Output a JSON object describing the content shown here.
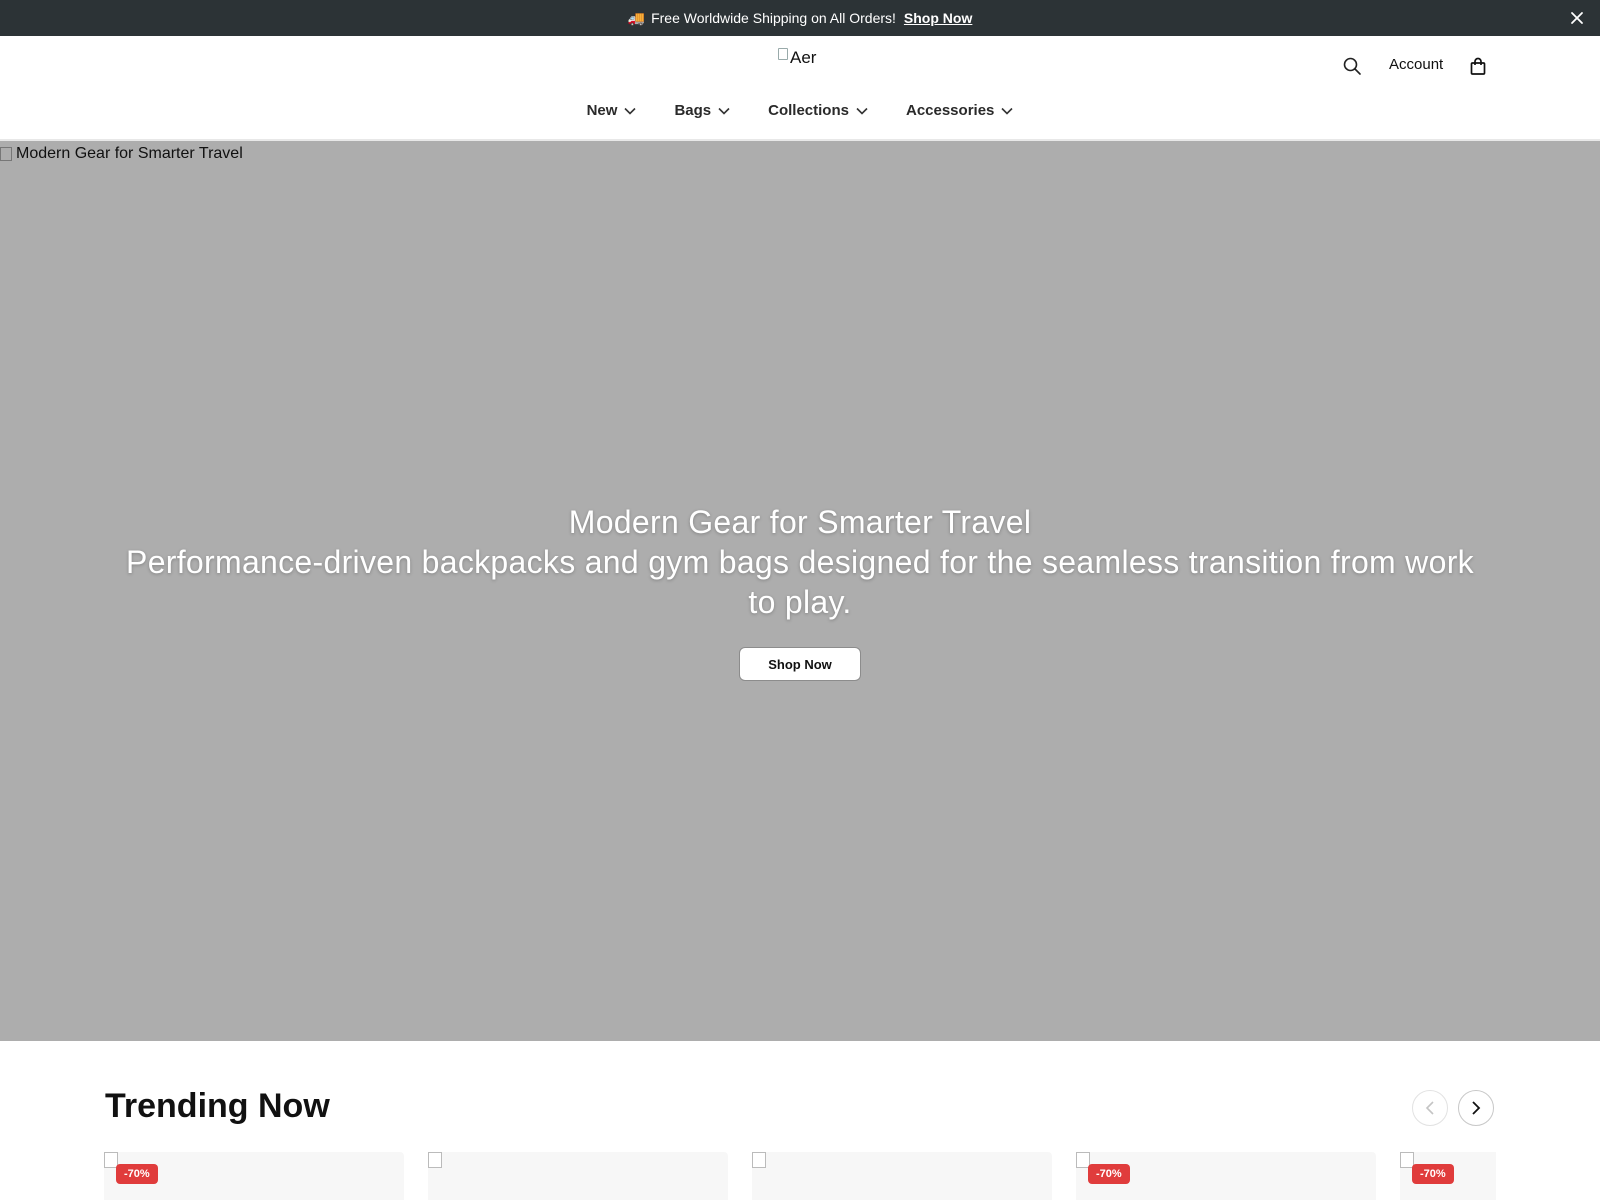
{
  "announcement": {
    "icon": "truck-emoji",
    "emoji": "🚚",
    "message": "Free Worldwide Shipping on All Orders!",
    "link_label": "Shop Now"
  },
  "header": {
    "logo_alt": "Aer",
    "account_label": "Account",
    "nav": [
      {
        "label": "New"
      },
      {
        "label": "Bags"
      },
      {
        "label": "Collections"
      },
      {
        "label": "Accessories"
      }
    ]
  },
  "hero": {
    "image_alt": "Modern Gear for Smarter Travel",
    "title": "Modern Gear for Smarter Travel",
    "subtitle": "Performance-driven backpacks and gym bags designed for the seamless transition from work to play.",
    "cta_label": "Shop Now"
  },
  "trending": {
    "title": "Trending Now",
    "cards": [
      {
        "badge": "-70%"
      },
      {
        "badge": ""
      },
      {
        "badge": ""
      },
      {
        "badge": "-70%"
      },
      {
        "badge": "-70%"
      }
    ]
  },
  "colors": {
    "announcement_bg": "#2c3336",
    "hero_bg": "#adadad",
    "badge_bg": "#e03c3c"
  }
}
